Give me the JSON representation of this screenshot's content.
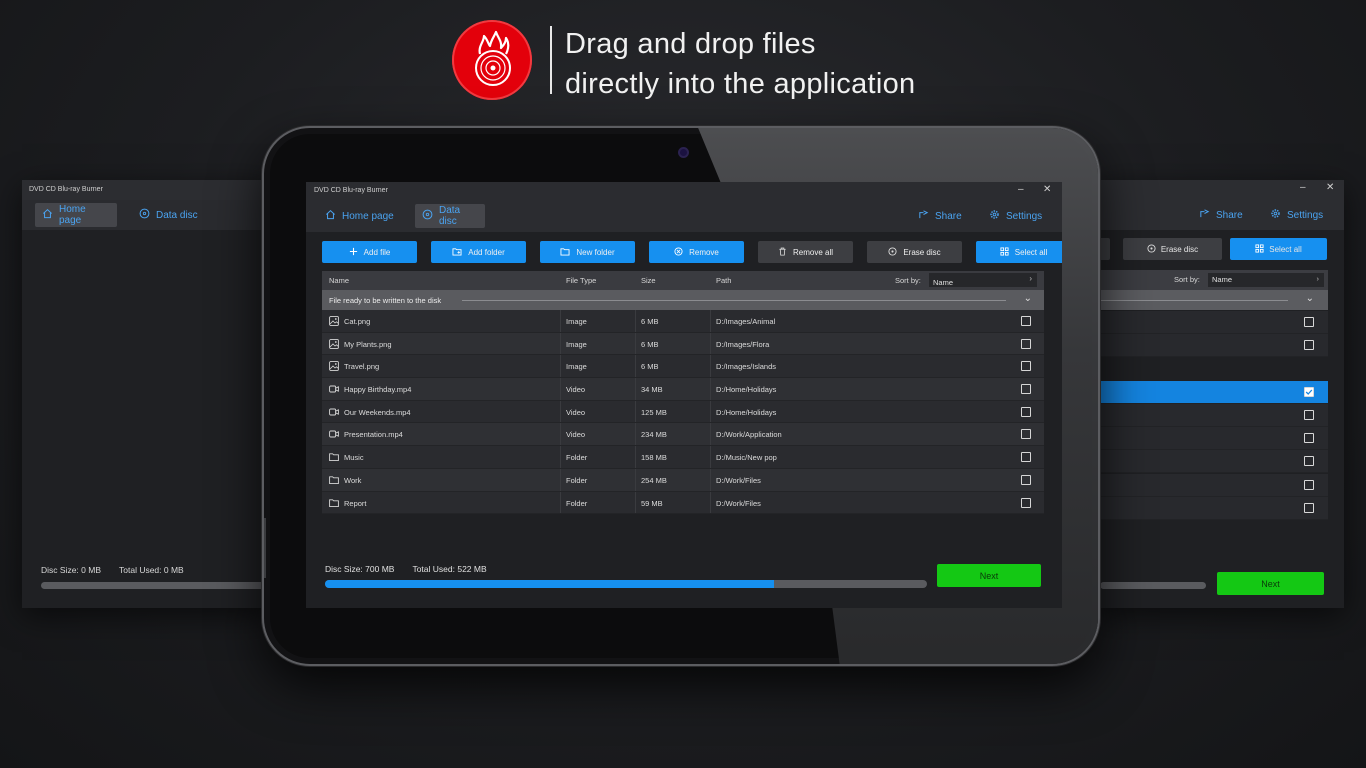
{
  "hero": {
    "line1": "Drag and drop files",
    "line2": "directly into the application"
  },
  "app": {
    "title": "DVD CD Blu-ray Burner",
    "nav": {
      "home": "Home page",
      "data_disc": "Data disc",
      "share": "Share",
      "settings": "Settings"
    },
    "actions": {
      "add_file": "Add file",
      "add_folder": "Add folder",
      "new_folder": "New folder",
      "remove": "Remove",
      "remove_all": "Remove all",
      "erase_disc": "Erase disc",
      "select_all": "Select all"
    },
    "columns": {
      "name": "Name",
      "type": "File Type",
      "size": "Size",
      "path": "Path",
      "sort_by": "Sort by:",
      "sort_value": "Name"
    },
    "group_label": "File ready to be written to the disk",
    "files": [
      {
        "icon": "image-icon",
        "name": "Cat.png",
        "type": "Image",
        "size": "6 MB",
        "path": "D:/Images/Animal"
      },
      {
        "icon": "image-icon",
        "name": "My Plants.png",
        "type": "Image",
        "size": "6 MB",
        "path": "D:/Images/Flora"
      },
      {
        "icon": "image-icon",
        "name": "Travel.png",
        "type": "Image",
        "size": "6 MB",
        "path": "D:/Images/Islands"
      },
      {
        "icon": "video-icon",
        "name": "Happy Birthday.mp4",
        "type": "Video",
        "size": "34 MB",
        "path": "D:/Home/Holidays"
      },
      {
        "icon": "video-icon",
        "name": "Our Weekends.mp4",
        "type": "Video",
        "size": "125 MB",
        "path": "D:/Home/Holidays"
      },
      {
        "icon": "video-icon",
        "name": "Presentation.mp4",
        "type": "Video",
        "size": "234 MB",
        "path": "D:/Work/Application"
      },
      {
        "icon": "folder-icon",
        "name": "Music",
        "type": "Folder",
        "size": "158 MB",
        "path": "D:/Music/New pop"
      },
      {
        "icon": "folder-icon",
        "name": "Work",
        "type": "Folder",
        "size": "254 MB",
        "path": "D:/Work/Files"
      },
      {
        "icon": "folder-icon",
        "name": "Report",
        "type": "Folder",
        "size": "59 MB",
        "path": "D:/Work/Files"
      }
    ],
    "disc_size": "Disc Size: 700 MB",
    "total_used": "Total Used: 522 MB",
    "usage_fraction": 0.7457,
    "next": "Next"
  },
  "left_window": {
    "title": "DVD CD Blu-ray Burner",
    "home": "Home page",
    "data_disc": "Data disc",
    "disc_size": "Disc Size: 0 MB",
    "total_used": "Total Used: 0 MB"
  },
  "right_window": {
    "share": "Share",
    "settings": "Settings",
    "erase_disc": "Erase disc",
    "select_all": "Select all",
    "sort_by": "Sort by:",
    "sort_value": "Name",
    "next": "Next"
  },
  "colors": {
    "accent": "#1690f0",
    "next": "#14c814",
    "logo": "#e3000b"
  }
}
